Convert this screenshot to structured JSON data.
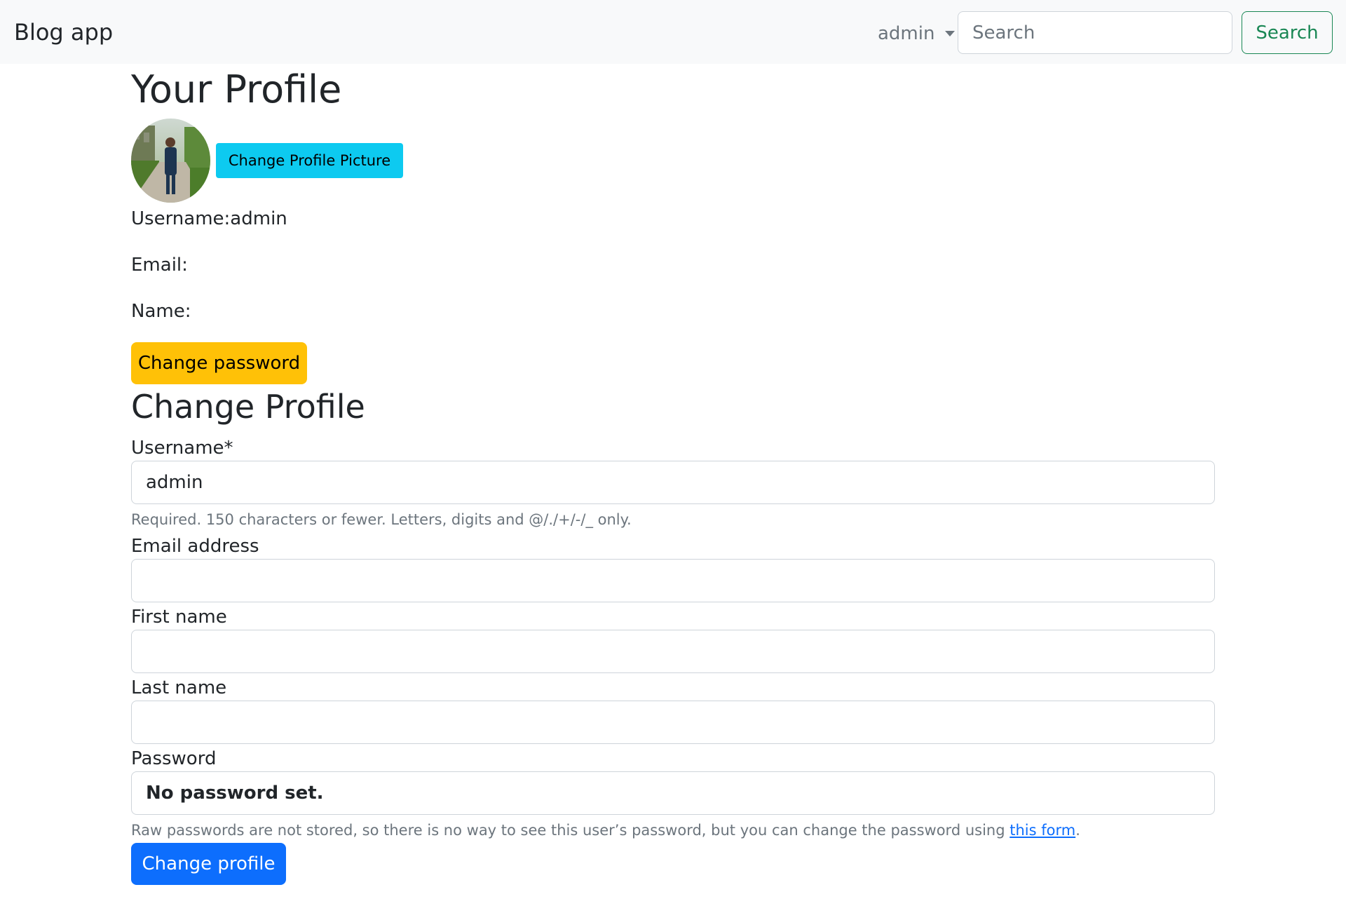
{
  "navbar": {
    "brand": "Blog app",
    "user_menu_label": "admin",
    "search_placeholder": "Search",
    "search_button": "Search"
  },
  "profile": {
    "title": "Your Profile",
    "change_picture_button": "Change Profile Picture",
    "username_line": "Username:admin",
    "email_line": "Email:",
    "name_line": "Name:",
    "change_password_button": "Change password"
  },
  "form": {
    "title": "Change Profile",
    "username": {
      "label": "Username*",
      "value": "admin",
      "help": "Required. 150 characters or fewer. Letters, digits and @/./+/-/_ only."
    },
    "email": {
      "label": "Email address",
      "value": ""
    },
    "first_name": {
      "label": "First name",
      "value": ""
    },
    "last_name": {
      "label": "Last name",
      "value": ""
    },
    "password": {
      "label": "Password",
      "value": "No password set.",
      "help_before": "Raw passwords are not stored, so there is no way to see this user’s password, but you can change the password using ",
      "help_link": "this form",
      "help_after": "."
    },
    "submit_button": "Change profile"
  },
  "colors": {
    "navbar_bg": "#f8f9fa",
    "info": "#0dcaf0",
    "warning": "#ffc107",
    "primary": "#0d6efd",
    "success": "#198754",
    "muted": "#6c757d"
  },
  "icons": {
    "user_menu": "caret-down-icon"
  }
}
